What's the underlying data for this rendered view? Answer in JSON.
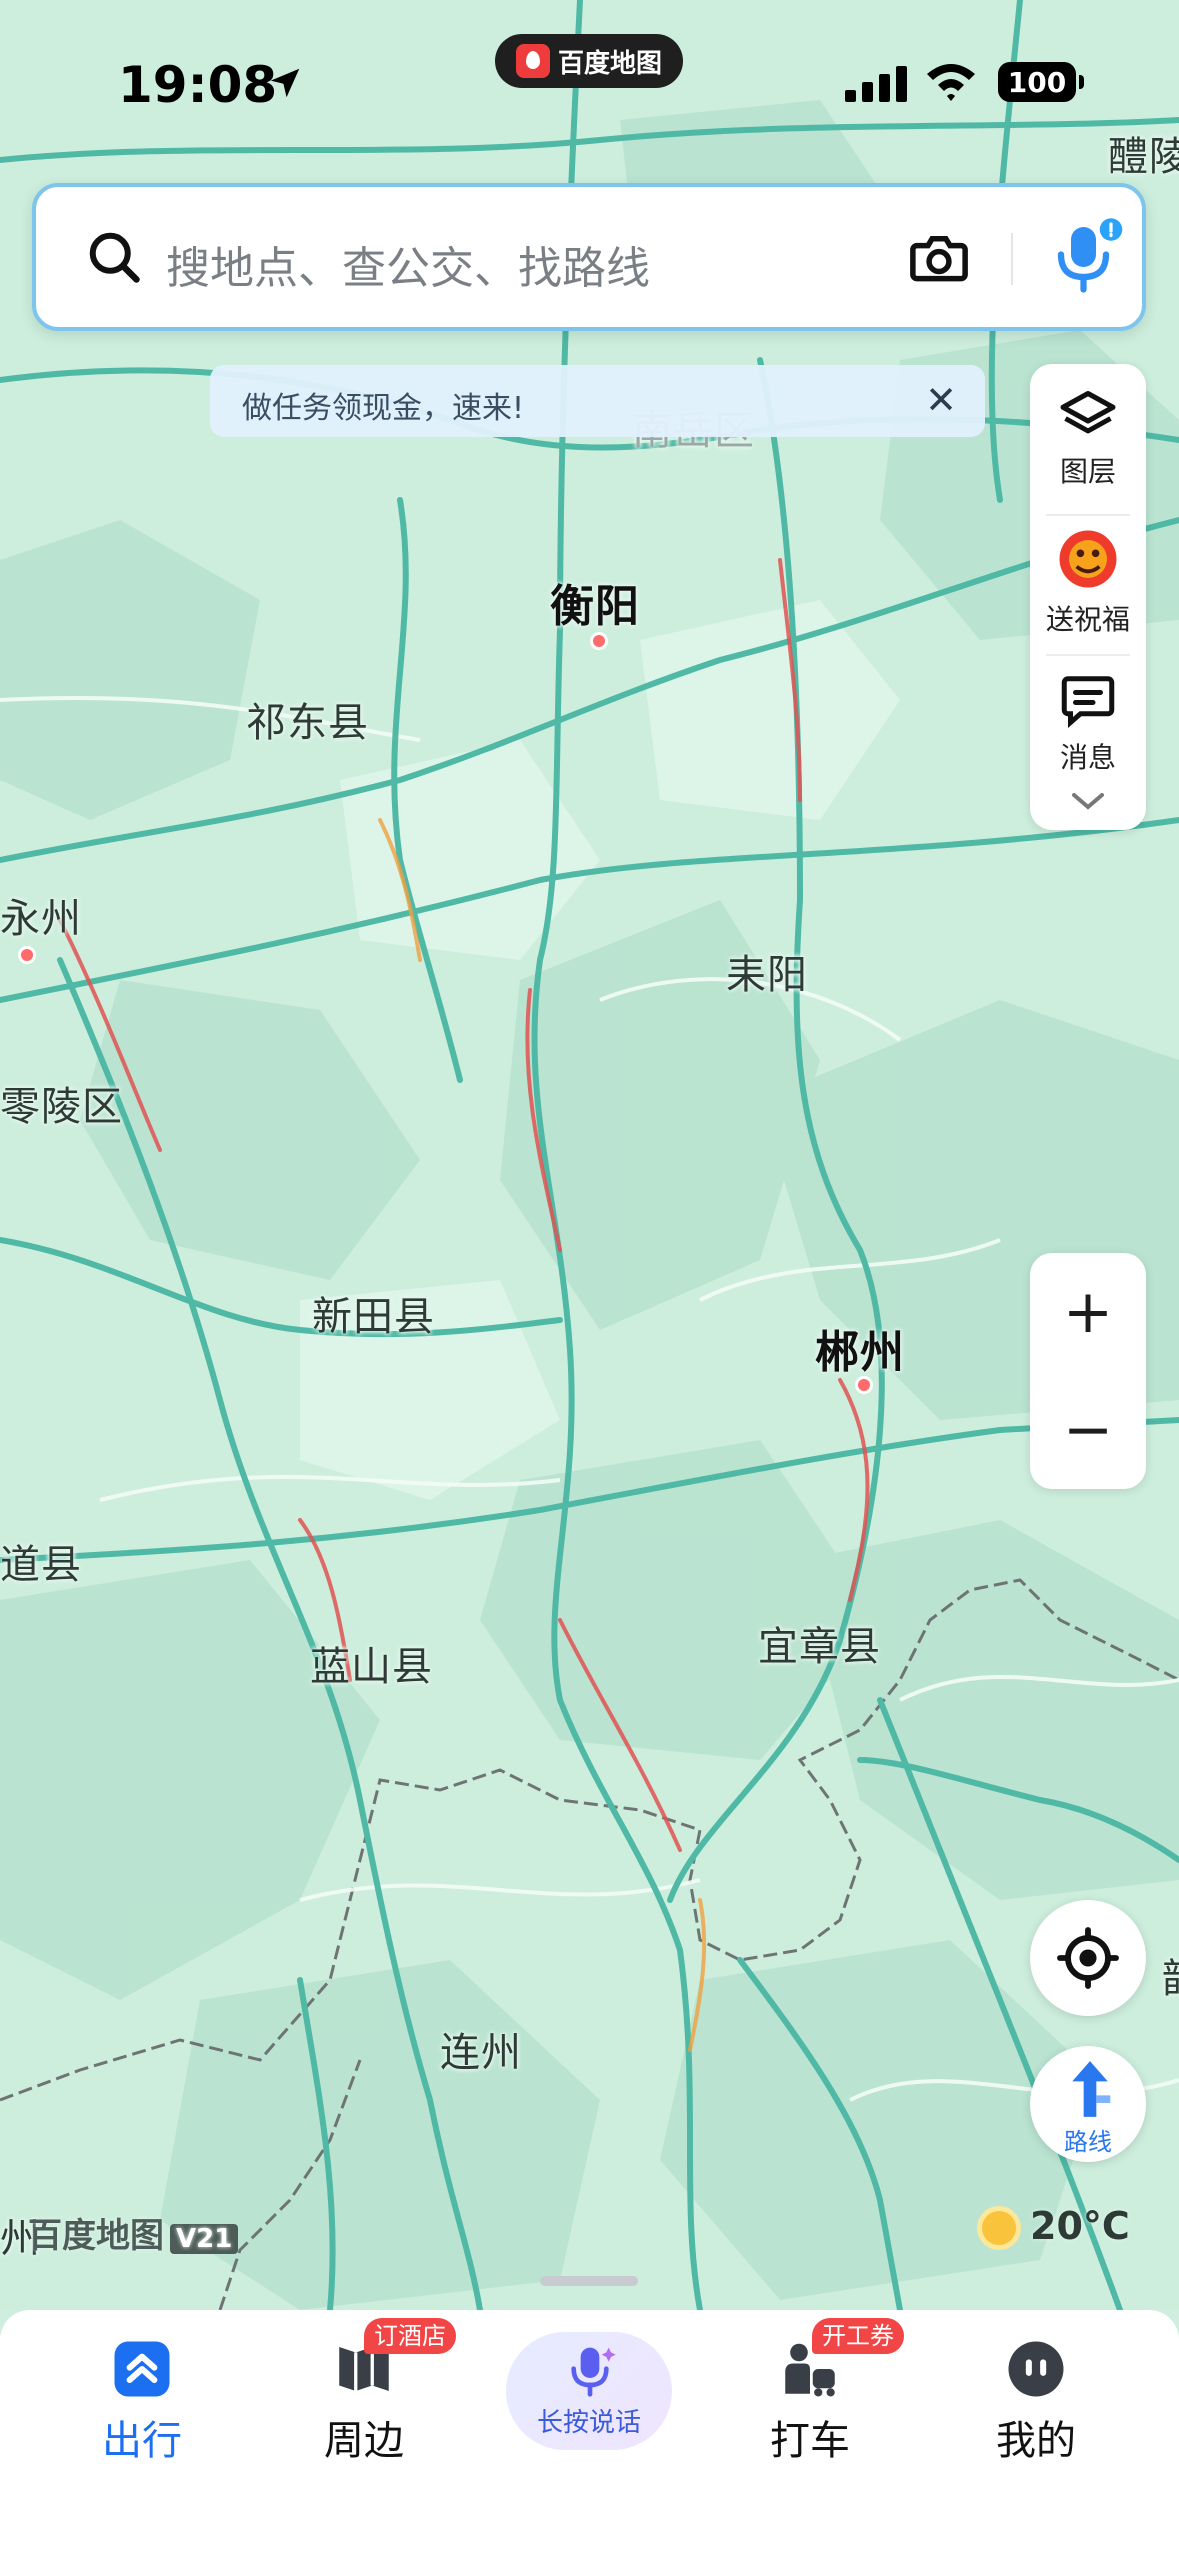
{
  "status_bar": {
    "time": "19:08",
    "app_name": "百度地图",
    "battery": "100"
  },
  "search": {
    "placeholder": "搜地点、查公交、找路线"
  },
  "banner": {
    "text": "做任务领现金，速来!",
    "close": "✕"
  },
  "tools": [
    {
      "label": "图层"
    },
    {
      "label": "送祝福"
    },
    {
      "label": "消息"
    }
  ],
  "zoom": {
    "in": "+",
    "out": "−"
  },
  "route_label": "路线",
  "map": {
    "watermark": "百度地图",
    "version": "V21",
    "temperature": "20°C",
    "labels": {
      "liling": "醴陵",
      "nanyue": "南岳区",
      "hengyang": "衡阳",
      "qidong": "祁东县",
      "yongzhou": "永州",
      "leiyang": "耒阳",
      "lingling": "零陵区",
      "xintian": "新田县",
      "chenzhou": "郴州",
      "dao": "道县",
      "yizhang": "宜章县",
      "lanshan": "蓝山县",
      "lianzhou": "连州",
      "right_edge": "韶",
      "left_edge": "州"
    }
  },
  "bottom_nav": {
    "chuxing": "出行",
    "zhoubian": "周边",
    "zhoubian_badge": "订酒店",
    "voice": "长按说话",
    "dache": "打车",
    "dache_badge": "开工券",
    "wode": "我的"
  },
  "colors": {
    "accent": "#1d6ff2",
    "map_base": "#cfeee0",
    "road": "#5cc2b0",
    "badge": "#f24545"
  }
}
